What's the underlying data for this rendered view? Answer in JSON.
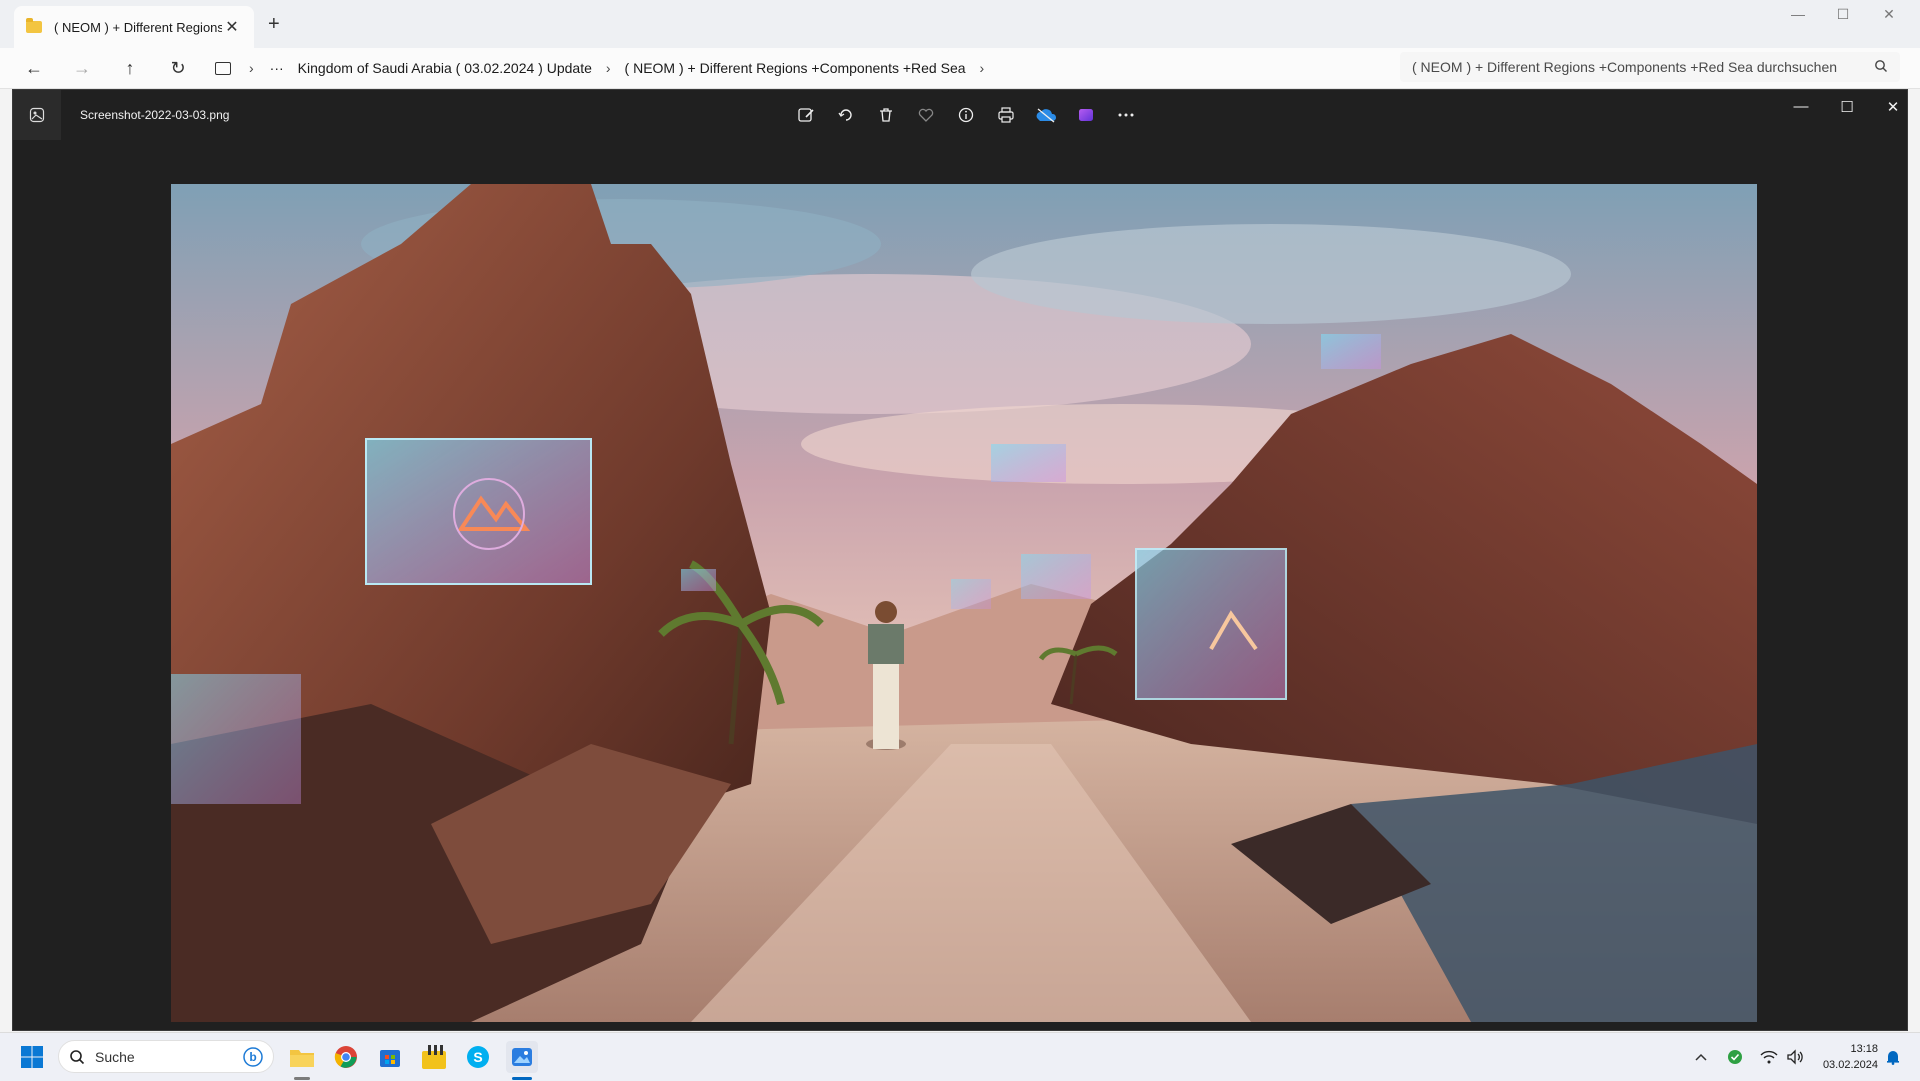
{
  "explorer": {
    "tab_title": "( NEOM ) + Different Regions",
    "breadcrumbs": [
      "Kingdom of Saudi Arabia ( 03.02.2024 ) Update",
      "( NEOM ) + Different Regions +Components +Red Sea"
    ],
    "search_placeholder": "( NEOM ) + Different Regions +Components +Red Sea durchsuchen"
  },
  "viewer": {
    "file_name": "Screenshot-2022-03-03.png",
    "toolbar_icons": [
      "edit-image-icon",
      "rotate-icon",
      "delete-icon",
      "favorite-icon",
      "info-icon",
      "print-icon",
      "onedrive-icon",
      "clipchamp-icon",
      "more-icon"
    ]
  },
  "taskbar": {
    "search_label": "Suche",
    "time": "13:18",
    "date": "03.02.2024"
  },
  "colors": {
    "accent": "#0067c0",
    "viewer_bg": "#202020"
  }
}
